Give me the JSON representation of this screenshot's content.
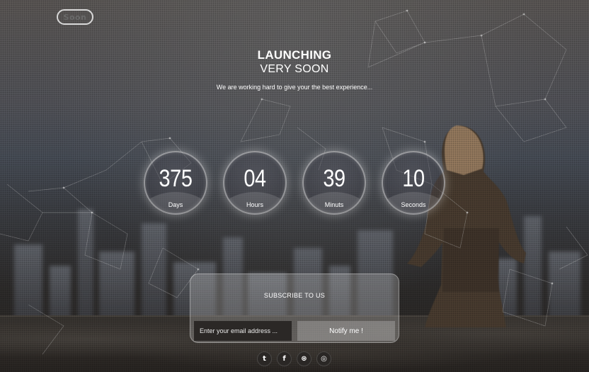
{
  "logo": {
    "text": "Soon"
  },
  "hero": {
    "title_line1": "LAUNCHING",
    "title_line2": "VERY SOON",
    "tagline": "We are working hard to give your the best experience..."
  },
  "countdown": [
    {
      "value": "375",
      "label": "Days"
    },
    {
      "value": "04",
      "label": "Hours"
    },
    {
      "value": "39",
      "label": "Minuts"
    },
    {
      "value": "10",
      "label": "Seconds"
    }
  ],
  "subscribe": {
    "title": "SUBSCRIBE TO US",
    "email_placeholder": "Enter your email address ...",
    "button_label": "Notify me !"
  },
  "social": [
    {
      "icon": "twitter-icon",
      "glyph": "t"
    },
    {
      "icon": "facebook-icon",
      "glyph": "f"
    },
    {
      "icon": "dribbble-icon",
      "glyph": "⊛"
    },
    {
      "icon": "instagram-icon",
      "glyph": "◎"
    }
  ]
}
